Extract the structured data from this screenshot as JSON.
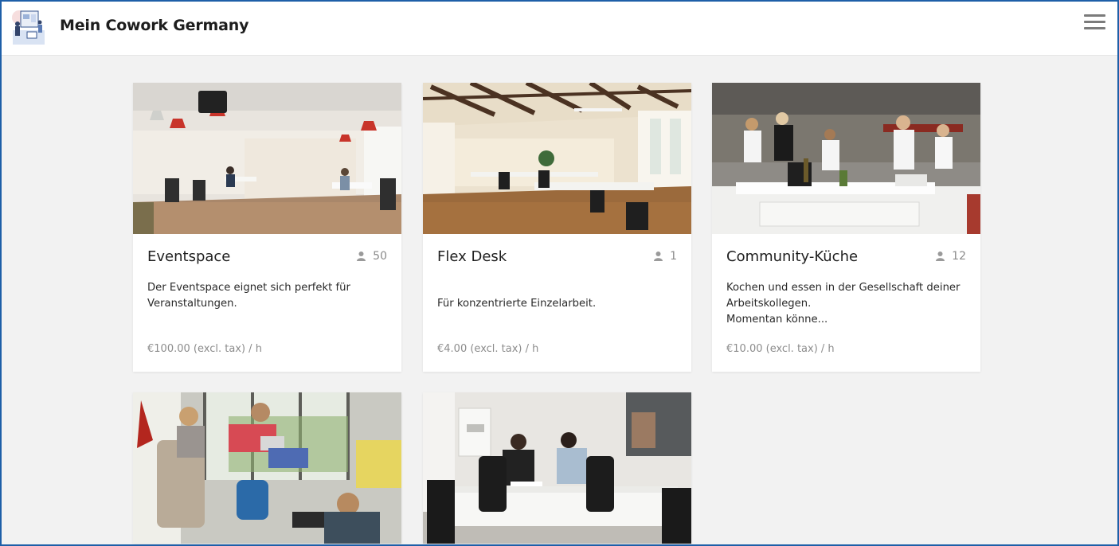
{
  "header": {
    "brand": "Mein Cowork Germany",
    "logo_icon": "cowork-illustration-logo",
    "menu_icon": "hamburger-menu-icon"
  },
  "spaces": [
    {
      "title": "Eventspace",
      "capacity": "50",
      "description_lines": [
        "Der Eventspace eignet sich perfekt für",
        "Veranstaltungen."
      ],
      "price": "€100.00 (excl. tax) / h",
      "image": "event-hall-photo"
    },
    {
      "title": "Flex Desk",
      "capacity": "1",
      "description_lines": [
        "",
        "Für konzentrierte Einzelarbeit."
      ],
      "price": "€4.00 (excl. tax) / h",
      "image": "open-office-photo"
    },
    {
      "title": "Community-Küche",
      "capacity": "12",
      "description_lines": [
        "Kochen und essen in der Gesellschaft deiner",
        "Arbeitskollegen.",
        "Momentan könne..."
      ],
      "price": "€10.00 (excl. tax) / h",
      "image": "kitchen-photo"
    },
    {
      "image": "lounge-photo"
    },
    {
      "image": "meeting-room-photo"
    }
  ],
  "colors": {
    "page_bg": "#f2f2f2",
    "frame_border": "#1e5fa8",
    "muted_text": "#8c8c8c"
  }
}
